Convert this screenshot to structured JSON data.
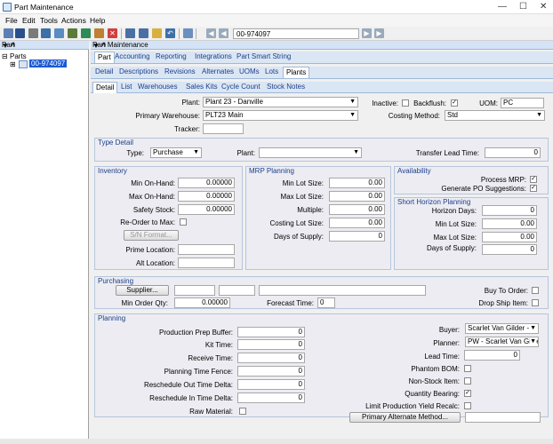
{
  "window": {
    "title": "Part Maintenance"
  },
  "menu": [
    "File",
    "Edit",
    "Tools",
    "Actions",
    "Help"
  ],
  "toolbar": {
    "part_combo": "00-974097"
  },
  "left_panel": {
    "header": "Part",
    "tree_root": "Parts",
    "tree_item": "00-974097"
  },
  "right_panel": {
    "header": "Part Maintenance"
  },
  "top_tabs": [
    "Part",
    "Accounting",
    "Reporting",
    "Integrations",
    "Part Smart String"
  ],
  "sub_tabs": [
    "Detail",
    "Descriptions",
    "Revisions",
    "Alternates",
    "UOMs",
    "Lots",
    "Plants"
  ],
  "sub_sub_tabs": [
    "Detail",
    "List",
    "Warehouses",
    "Sales Kits",
    "Cycle Count",
    "Stock Notes"
  ],
  "header_fields": {
    "plant_label": "Plant:",
    "plant_value": "Plant 23 - Danville",
    "primary_wh_label": "Primary Warehouse:",
    "primary_wh_value": "PLT23 Main",
    "tracker_label": "Tracker:",
    "inactive_label": "Inactive:",
    "backflush_label": "Backflush:",
    "uom_label": "UOM:",
    "uom_value": "PC",
    "costing_label": "Costing Method:",
    "costing_value": "Std"
  },
  "type_detail": {
    "title": "Type Detail",
    "type_label": "Type:",
    "type_value": "Purchase",
    "plant_label": "Plant:",
    "tlt_label": "Transfer Lead Time:",
    "tlt_value": "0"
  },
  "inventory": {
    "title": "Inventory",
    "min_label": "Min On-Hand:",
    "min_value": "0.00000",
    "max_label": "Max On-Hand:",
    "max_value": "0.00000",
    "safety_label": "Safety Stock:",
    "safety_value": "0.00000",
    "reorder_label": "Re-Order to Max:",
    "sn_button": "S/N Format...",
    "prime_label": "Prime Location:",
    "alt_label": "Alt Location:"
  },
  "mrp": {
    "title": "MRP Planning",
    "minlot_label": "Min Lot Size:",
    "minlot_value": "0.00",
    "maxlot_label": "Max Lot Size:",
    "maxlot_value": "0.00",
    "multiple_label": "Multiple:",
    "multiple_value": "0.00",
    "costlot_label": "Costing Lot Size:",
    "costlot_value": "0.00",
    "days_label": "Days of Supply:",
    "days_value": "0"
  },
  "availability": {
    "title": "Availability",
    "process_label": "Process MRP:",
    "genpo_label": "Generate PO Suggestions:"
  },
  "short_horizon": {
    "title": "Short Horizon Planning",
    "hdays_label": "Horizon Days:",
    "hdays_value": "0",
    "minlot_label": "Min Lot Size:",
    "minlot_value": "0.00",
    "maxlot_label": "Max Lot Size:",
    "maxlot_value": "0.00",
    "days_label": "Days of Supply:",
    "days_value": "0"
  },
  "purchasing": {
    "title": "Purchasing",
    "supplier_button": "Supplier...",
    "minorder_label": "Min Order Qty:",
    "minorder_value": "0.00000",
    "forecast_label": "Forecast Time:",
    "forecast_value": "0",
    "buytoorder_label": "Buy To Order:",
    "dropship_label": "Drop Ship Item:"
  },
  "planning": {
    "title": "Planning",
    "prodprep_label": "Production Prep Buffer:",
    "prodprep_value": "0",
    "kit_label": "Kit Time:",
    "kit_value": "0",
    "receive_label": "Receive Time:",
    "receive_value": "0",
    "fence_label": "Planning Time Fence:",
    "fence_value": "0",
    "resout_label": "Reschedule Out Time Delta:",
    "resout_value": "0",
    "resin_label": "Reschedule In Time Delta:",
    "resin_value": "0",
    "raw_label": "Raw Material:",
    "buyer_label": "Buyer:",
    "buyer_value": "Scarlet Van Gilder - F",
    "planner_label": "Planner:",
    "planner_value": "PW - Scarlet Van Gilde",
    "lead_label": "Lead Time:",
    "lead_value": "0",
    "phantom_label": "Phantom BOM:",
    "nonstock_label": "Non-Stock Item:",
    "qtybearing_label": "Quantity Bearing:",
    "limitprod_label": "Limit Production Yield Recalc:",
    "primalt_button": "Primary Alternate Method..."
  },
  "colors": {
    "accent": "#1c3f8a",
    "tab_strip": "#dbe6f4",
    "header": "#d4e3f5"
  }
}
